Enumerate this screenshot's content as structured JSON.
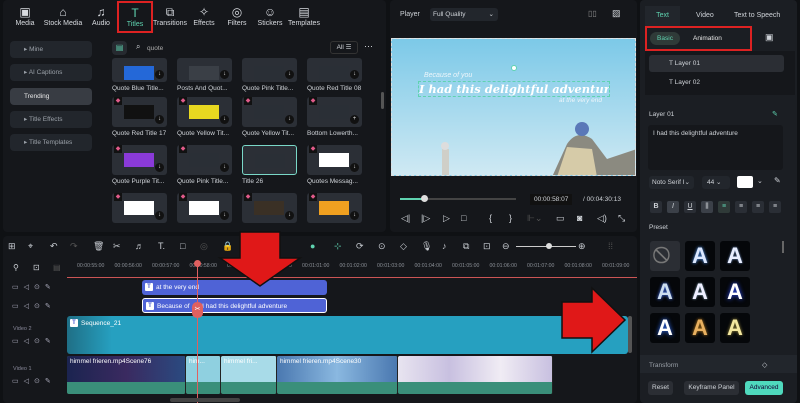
{
  "toolbar": {
    "items": [
      {
        "label": "Media",
        "icon": "media-icon"
      },
      {
        "label": "Stock Media",
        "icon": "stock-icon"
      },
      {
        "label": "Audio",
        "icon": "audio-icon"
      },
      {
        "label": "Titles",
        "icon": "titles-icon",
        "active": true
      },
      {
        "label": "Transitions",
        "icon": "transitions-icon"
      },
      {
        "label": "Effects",
        "icon": "effects-icon"
      },
      {
        "label": "Filters",
        "icon": "filters-icon"
      },
      {
        "label": "Stickers",
        "icon": "stickers-icon"
      },
      {
        "label": "Templates",
        "icon": "templates-icon"
      }
    ]
  },
  "sidebar": {
    "items": [
      {
        "label": "Mine"
      },
      {
        "label": "AI Captions"
      },
      {
        "label": "Trending",
        "selected": true
      },
      {
        "label": "Title Effects"
      },
      {
        "label": "Title Templates"
      }
    ]
  },
  "search": {
    "value": "quote",
    "filter": "All"
  },
  "grid": {
    "cards": [
      {
        "label": "Quote Blue Title..."
      },
      {
        "label": "Posts And Quot..."
      },
      {
        "label": "Quote Pink Title..."
      },
      {
        "label": "Quote Red Title 08"
      },
      {
        "label": "Quote Red Title 17"
      },
      {
        "label": "Quote Yellow Tit..."
      },
      {
        "label": "Quote Yellow Tit..."
      },
      {
        "label": "Bottom Lowerth..."
      },
      {
        "label": "Quote Purple Tit..."
      },
      {
        "label": "Quote Pink Title..."
      },
      {
        "label": "Title 26"
      },
      {
        "label": "Quotes Messag..."
      },
      {
        "label": ""
      },
      {
        "label": ""
      },
      {
        "label": ""
      },
      {
        "label": ""
      }
    ]
  },
  "player": {
    "label": "Player",
    "quality": "Full Quality",
    "current_time": "00:00:58:07",
    "total_time": "/ 00:04:30:13",
    "progress": 0.21,
    "overlay": {
      "line1": "Because of you",
      "line2": "I had this delightful adventure",
      "line3": "at the very end"
    }
  },
  "right": {
    "tabs": [
      "Text",
      "Video",
      "Text to Speech"
    ],
    "subtabs": [
      "Basic",
      "Animation"
    ],
    "layers": [
      "Layer 01",
      "Layer 02"
    ],
    "layer_title": "Layer 01",
    "text_value": "I had this delightful adventure",
    "font": "Noto Serif I",
    "size": "44",
    "format": [
      "B",
      "I",
      "U"
    ],
    "preset_label": "Preset",
    "transform_label": "Transform",
    "buttons": {
      "reset": "Reset",
      "keyframe": "Keyframe Panel",
      "advanced": "Advanced"
    }
  },
  "timeline": {
    "ticks": [
      "00:00:55:00",
      "00:00:56:00",
      "00:00:57:00",
      "00:00:58:00",
      "00:00:59:00",
      "00:01:00:00",
      "00:01:01:00",
      "00:01:02:00",
      "00:01:03:00",
      "00:01:04:00",
      "00:01:05:00",
      "00:01:06:00",
      "00:01:07:00",
      "00:01:08:00",
      "00:01:09:00"
    ],
    "tracks": {
      "video2": "Video 2",
      "video1": "Video 1"
    },
    "clips": {
      "title1": "at the very end",
      "title2": "Because of ... / I had this delightful adventure",
      "sequence": "Sequence_21",
      "video": [
        "himmel frieren.mp4Scene76",
        "him...",
        "himmel fri...",
        "himmel frieren.mp4Scene30",
        ""
      ]
    }
  },
  "colors": {
    "accent": "#5fd3b0",
    "highlight": "#d22222",
    "title_clip": "#4f63d6",
    "sequence": "#26a0c0"
  }
}
